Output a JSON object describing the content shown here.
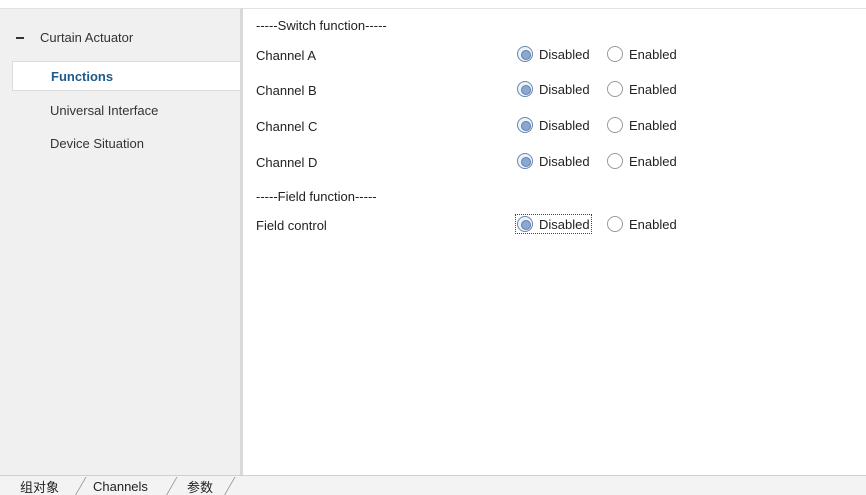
{
  "sidebar": {
    "root_label": "Curtain Actuator",
    "items": [
      {
        "label": "Functions",
        "active": true
      },
      {
        "label": "Universal Interface",
        "active": false
      },
      {
        "label": "Device Situation",
        "active": false
      }
    ]
  },
  "content": {
    "switch_header": "-----Switch function-----",
    "field_header": "-----Field function-----",
    "option_disabled": "Disabled",
    "option_enabled": "Enabled",
    "channels": [
      {
        "label": "Channel A",
        "value": "Disabled"
      },
      {
        "label": "Channel B",
        "value": "Disabled"
      },
      {
        "label": "Channel C",
        "value": "Disabled"
      },
      {
        "label": "Channel D",
        "value": "Disabled"
      }
    ],
    "field_control": {
      "label": "Field control",
      "value": "Disabled"
    }
  },
  "tabs": [
    {
      "label": "组对象"
    },
    {
      "label": "Channels"
    },
    {
      "label": "参数",
      "active": true
    }
  ]
}
